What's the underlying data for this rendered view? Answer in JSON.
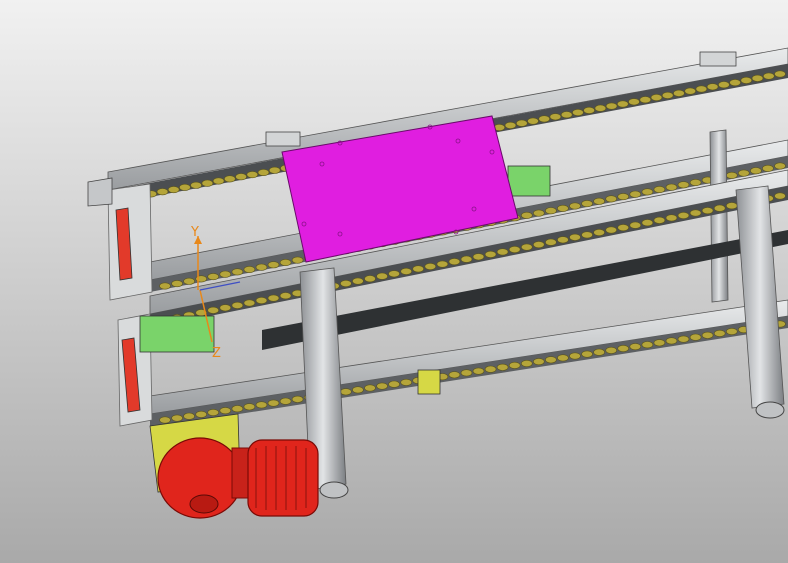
{
  "view": {
    "background_top": "#f1f1f1",
    "background_bottom": "#a9a9a9"
  },
  "colors": {
    "frame": "#c9ccce",
    "frame_dark": "#6c6f73",
    "belt": "#4b4e51",
    "roller": "#b5a53a",
    "carrier_plate": "#e01ee0",
    "bracket_green": "#7ad36a",
    "bracket_yellow": "#d6d845",
    "motor_red": "#e0251c"
  },
  "icons": [
    "triad-icon",
    "gear-motor-icon"
  ],
  "triad": {
    "z_label": "Z",
    "y_label": "Y",
    "z_color": "#e8881a",
    "y_color": "#e8881a"
  }
}
